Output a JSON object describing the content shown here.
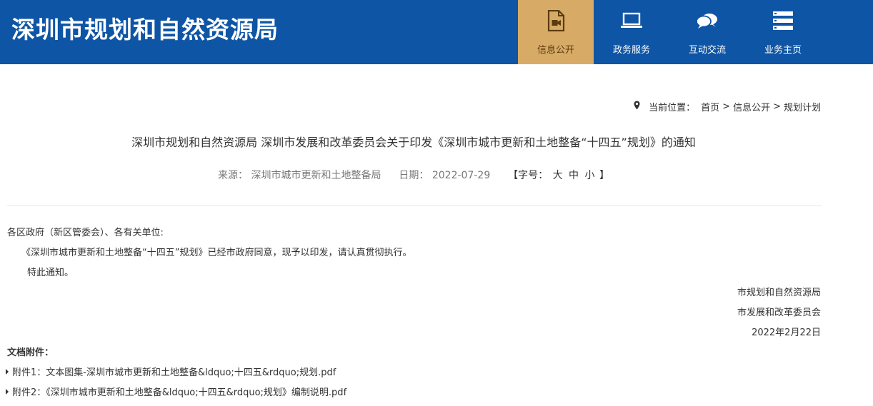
{
  "header": {
    "site_title": "深圳市规划和自然资源局",
    "nav": [
      {
        "label": "信息公开",
        "icon": "video-document-icon",
        "active": true
      },
      {
        "label": "政务服务",
        "icon": "laptop-icon",
        "active": false
      },
      {
        "label": "互动交流",
        "icon": "chat-bubbles-icon",
        "active": false
      },
      {
        "label": "业务主页",
        "icon": "server-list-icon",
        "active": false
      }
    ]
  },
  "breadcrumb": {
    "prefix": "当前位置：",
    "items": [
      "首页",
      "信息公开",
      "规划计划"
    ],
    "separator": ">"
  },
  "article": {
    "title": "深圳市规划和自然资源局 深圳市发展和改革委员会关于印发《深圳市城市更新和土地整备“十四五”规划》的通知",
    "source_label": "来源：",
    "source": "深圳市城市更新和土地整备局",
    "date_label": "日期：",
    "date": "2022-07-29",
    "font_size_label": "【字号：",
    "font_large": "大",
    "font_medium": "中",
    "font_small": "小",
    "font_size_end": "】",
    "salutation": "各区政府（新区管委会）、各有关单位:",
    "body": "《深圳市城市更新和土地整备“十四五”规划》已经市政府同意，现予以印发，请认真贯彻执行。",
    "closing": "特此通知。",
    "signatures": [
      "市规划和自然资源局",
      "市发展和改革委员会"
    ],
    "sign_date": "2022年2月22日"
  },
  "attachments": {
    "title": "文档附件：",
    "items": [
      "附件1：文本图集-深圳市城市更新和土地整备&ldquo;十四五&rdquo;规划.pdf",
      "附件2：《深圳市城市更新和土地整备&ldquo;十四五&rdquo;规划》编制说明.pdf"
    ]
  }
}
